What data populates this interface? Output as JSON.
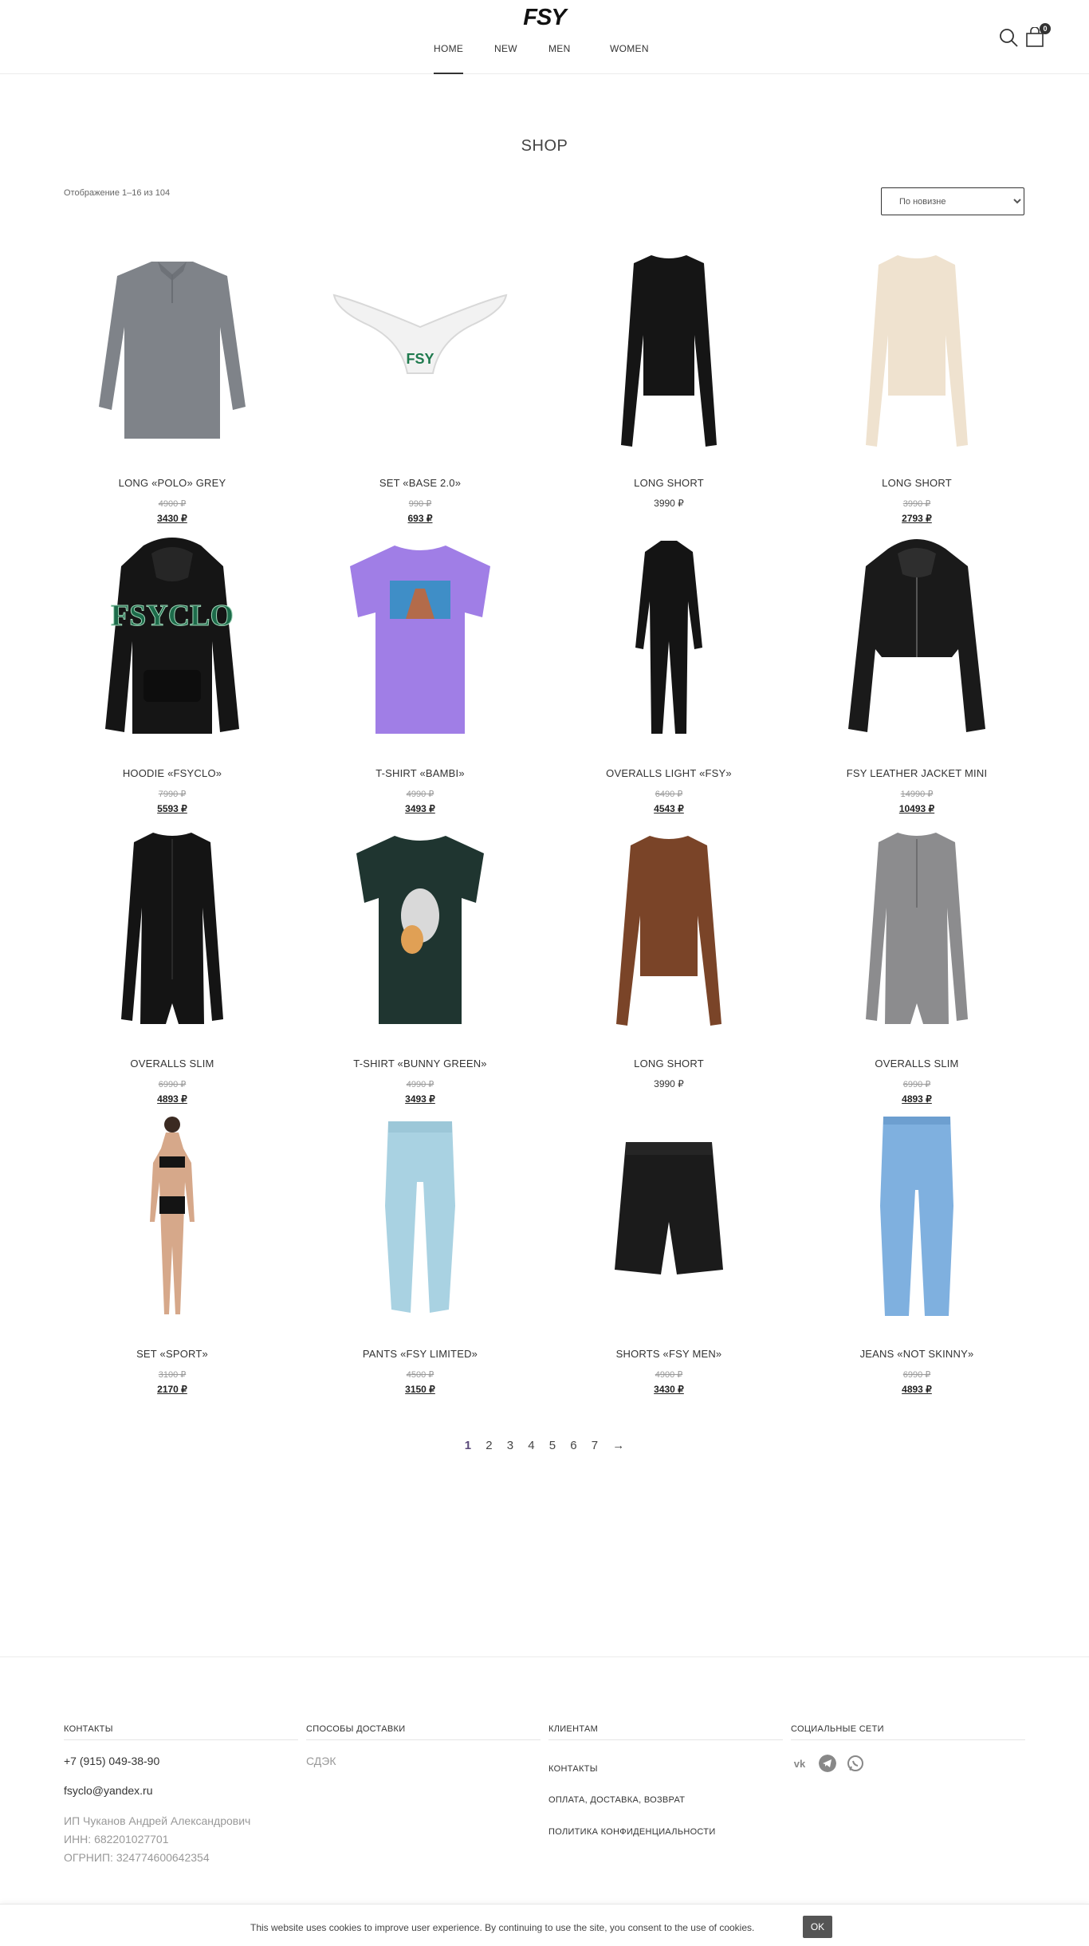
{
  "header": {
    "logo": "FSY",
    "nav": [
      "HOME",
      "NEW",
      "MEN",
      "WOMEN"
    ],
    "cart_count": "0",
    "icons": [
      "search-icon",
      "cart-icon"
    ]
  },
  "shop": {
    "title": "SHOP",
    "result_count": "Отображение 1–16 из 104",
    "orderby_selected": "По новизне"
  },
  "products": [
    {
      "name": "LONG «POLO» GREY",
      "old_price": "4900 ₽",
      "price": "3430 ₽"
    },
    {
      "name": "SET «BASE 2.0»",
      "old_price": "990 ₽",
      "price": "693 ₽"
    },
    {
      "name": "LONG SHORT",
      "old_price": "",
      "price": "3990 ₽"
    },
    {
      "name": "LONG SHORT",
      "old_price": "3990 ₽",
      "price": "2793 ₽"
    },
    {
      "name": "HOODIE «FSYCLO»",
      "old_price": "7990 ₽",
      "price": "5593 ₽"
    },
    {
      "name": "T-SHIRT «BAMBI»",
      "old_price": "4990 ₽",
      "price": "3493 ₽"
    },
    {
      "name": "OVERALLS LIGHT «FSY»",
      "old_price": "6490 ₽",
      "price": "4543 ₽"
    },
    {
      "name": "FSY LEATHER JACKET MINI",
      "old_price": "14990 ₽",
      "price": "10493 ₽"
    },
    {
      "name": "OVERALLS SLIM",
      "old_price": "6990 ₽",
      "price": "4893 ₽"
    },
    {
      "name": "T-SHIRT «BUNNY GREEN»",
      "old_price": "4990 ₽",
      "price": "3493 ₽"
    },
    {
      "name": "LONG SHORT",
      "old_price": "",
      "price": "3990 ₽"
    },
    {
      "name": "OVERALLS SLIM",
      "old_price": "6990 ₽",
      "price": "4893 ₽"
    },
    {
      "name": "SET «SPORT»",
      "old_price": "3100 ₽",
      "price": "2170 ₽"
    },
    {
      "name": "PANTS «FSY LIMITED»",
      "old_price": "4500 ₽",
      "price": "3150 ₽"
    },
    {
      "name": "SHORTS «FSY MEN»",
      "old_price": "4900 ₽",
      "price": "3430 ₽"
    },
    {
      "name": "JEANS «NOT SKINNY»",
      "old_price": "6990 ₽",
      "price": "4893 ₽"
    }
  ],
  "product_print": {
    "fsy": "FSY",
    "fsyclo": "FSYCLO"
  },
  "pagination": {
    "pages": [
      "1",
      "2",
      "3",
      "4",
      "5",
      "6",
      "7"
    ],
    "current": "1",
    "next": "→"
  },
  "footer": {
    "contacts": {
      "heading": "КОНТАКТЫ",
      "phone": "+7 (915) 049-38-90",
      "email": "fsyclo@yandex.ru",
      "entity": "ИП Чуканов Андрей Александрович",
      "inn": "ИНН: 682201027701",
      "ogrnip": "ОГРНИП: 324774600642354"
    },
    "delivery": {
      "heading": "СПОСОБЫ ДОСТАВКИ",
      "item": "СДЭК"
    },
    "clients": {
      "heading": "КЛИЕНТАМ",
      "links": [
        "КОНТАКТЫ",
        "ОПЛАТА, ДОСТАВКА, ВОЗВРАТ",
        "ПОЛИТИКА КОНФИДЕНЦИАЛЬНОСТИ"
      ]
    },
    "social": {
      "heading": "СОЦИАЛЬНЫЕ СЕТИ",
      "icons": [
        "vk-icon",
        "telegram-icon",
        "whatsapp-icon"
      ]
    }
  },
  "cookie": {
    "text": "This website uses cookies to improve user experience. By continuing to use the site, you consent to the use of cookies.",
    "ok": "OK"
  },
  "colors": {
    "accent": "#5b4a7a",
    "text": "#333333",
    "muted": "#999999"
  }
}
